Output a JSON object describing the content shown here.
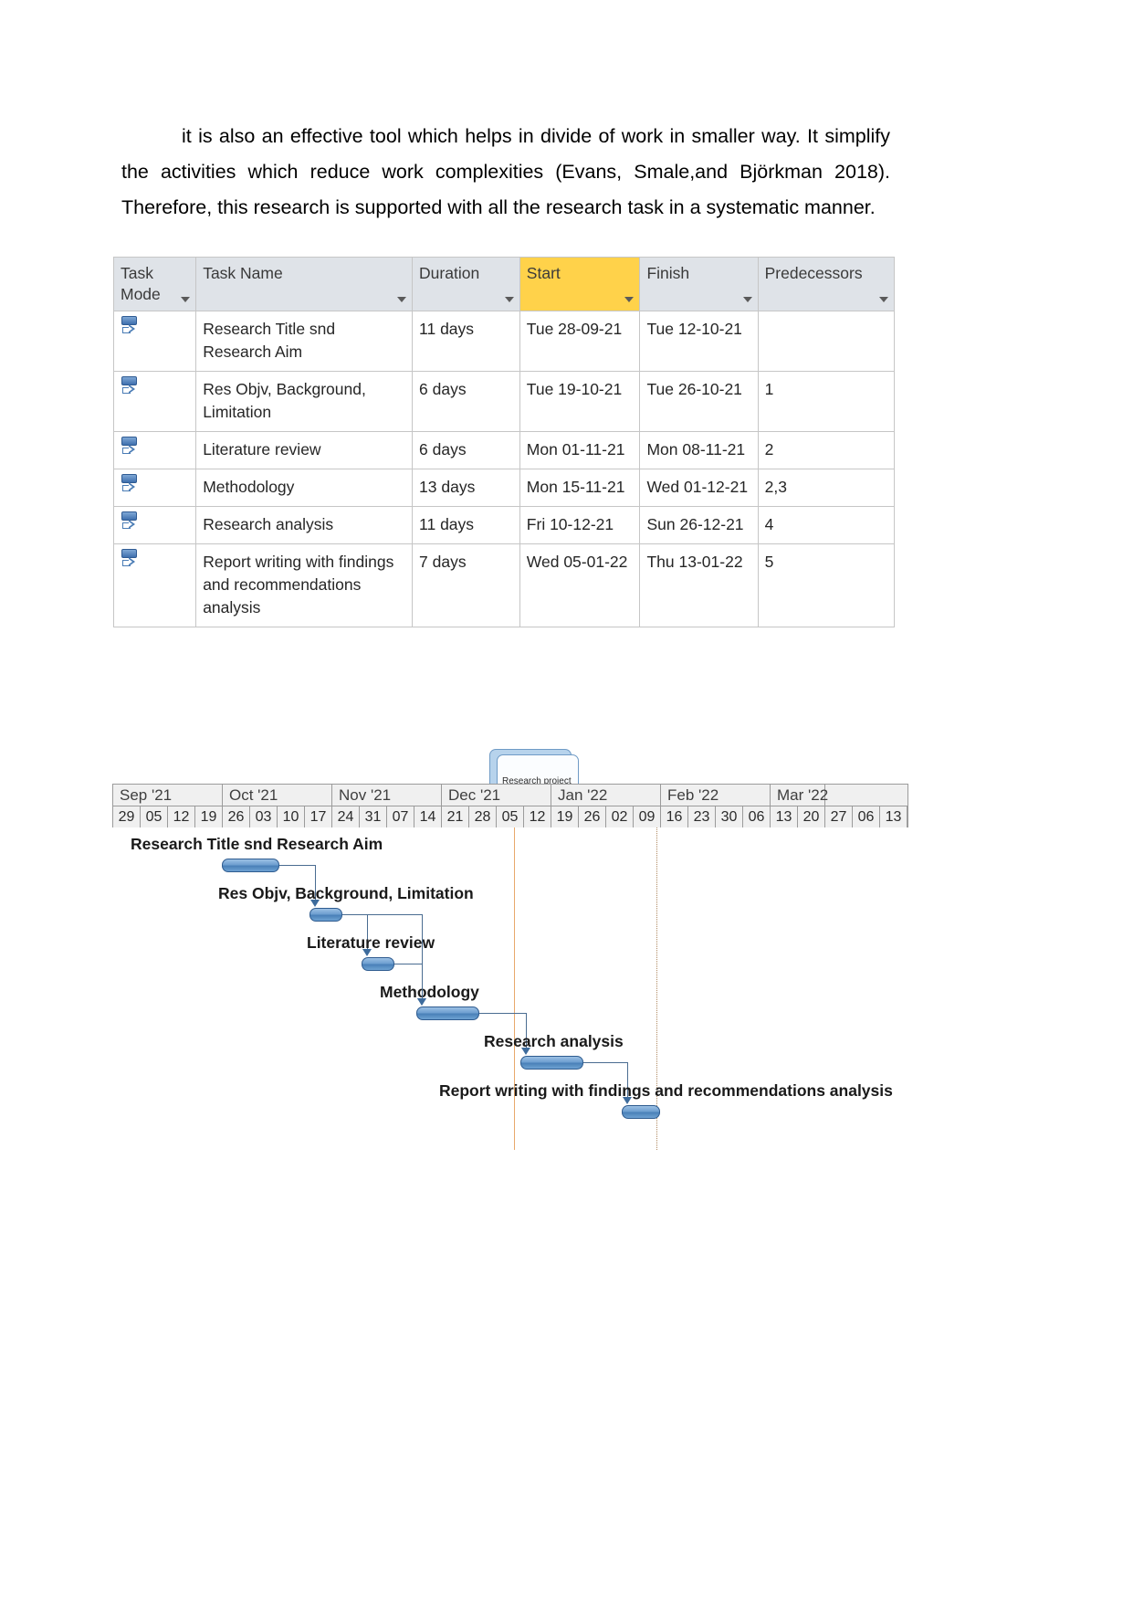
{
  "paragraph": {
    "text": "it is also an effective tool which helps in divide of work in smaller way. It simplify the activities which reduce work complexities (Evans,  Smale,and Björkman 2018). Therefore, this research is supported with all the research task in a systematic manner."
  },
  "table": {
    "columns": [
      {
        "label": "Task Mode",
        "filter": true,
        "highlighted": false
      },
      {
        "label": "Task Name",
        "filter": true,
        "highlighted": false
      },
      {
        "label": "Duration",
        "filter": true,
        "highlighted": false
      },
      {
        "label": "Start",
        "filter": true,
        "highlighted": true
      },
      {
        "label": "Finish",
        "filter": true,
        "highlighted": false
      },
      {
        "label": "Predecessors",
        "filter": true,
        "highlighted": false
      }
    ],
    "header_highlight_color": "#ffd24a",
    "selected_row_color": "#e2edf7",
    "rows": [
      {
        "mode_icon": "manually-scheduled-icon",
        "name": "Research Title snd Research Aim",
        "duration": "11 days",
        "start": "Tue 28-09-21",
        "finish": "Tue 12-10-21",
        "predecessors": ""
      },
      {
        "mode_icon": "manually-scheduled-icon",
        "name": "Res Objv, Background, Limitation",
        "duration": "6 days",
        "start": "Tue 19-10-21",
        "finish": "Tue 26-10-21",
        "predecessors": "1"
      },
      {
        "mode_icon": "manually-scheduled-icon",
        "name": "Literature review",
        "duration": "6 days",
        "start": "Mon 01-11-21",
        "finish": "Mon 08-11-21",
        "predecessors": "2"
      },
      {
        "mode_icon": "manually-scheduled-icon",
        "name": "Methodology",
        "duration": "13 days",
        "start": "Mon 15-11-21",
        "finish": "Wed 01-12-21",
        "predecessors": "2,3"
      },
      {
        "mode_icon": "manually-scheduled-icon",
        "name": "Research analysis",
        "duration": "11 days",
        "start": "Fri 10-12-21",
        "finish": "Sun 26-12-21",
        "predecessors": "4"
      },
      {
        "mode_icon": "manually-scheduled-icon",
        "name": "Report writing with findings and recommendations analysis",
        "duration": "7 days",
        "start": "Wed 05-01-22",
        "finish": "Thu 13-01-22",
        "predecessors": "5"
      }
    ]
  },
  "gantt": {
    "project_tab_label": "Research project",
    "months": [
      {
        "label": "Sep '21",
        "weeks": 4
      },
      {
        "label": "Oct '21",
        "weeks": 4
      },
      {
        "label": "Nov '21",
        "weeks": 4
      },
      {
        "label": "Dec '21",
        "weeks": 4
      },
      {
        "label": "Jan '22",
        "weeks": 4
      },
      {
        "label": "Feb '22",
        "weeks": 4
      },
      {
        "label": "Mar '22",
        "weeks": 2
      }
    ],
    "weeks": [
      "29",
      "05",
      "12",
      "19",
      "26",
      "03",
      "10",
      "17",
      "24",
      "31",
      "07",
      "14",
      "21",
      "28",
      "05",
      "12",
      "19",
      "26",
      "02",
      "09",
      "16",
      "23",
      "30",
      "06",
      "13",
      "20",
      "27",
      "06",
      "13"
    ],
    "bars": [
      {
        "label": "Research Title snd Research Aim",
        "start_week": 4.0,
        "end_week": 6.1
      },
      {
        "label": "Res Objv, Background, Limitation",
        "start_week": 7.2,
        "end_week": 8.4
      },
      {
        "label": "Literature review",
        "start_week": 9.1,
        "end_week": 10.3
      },
      {
        "label": "Methodology",
        "start_week": 11.1,
        "end_week": 13.4
      },
      {
        "label": "Research analysis",
        "start_week": 14.9,
        "end_week": 17.2
      },
      {
        "label": "Report writing with findings and recommendations analysis",
        "start_week": 18.6,
        "end_week": 20.0
      }
    ]
  }
}
